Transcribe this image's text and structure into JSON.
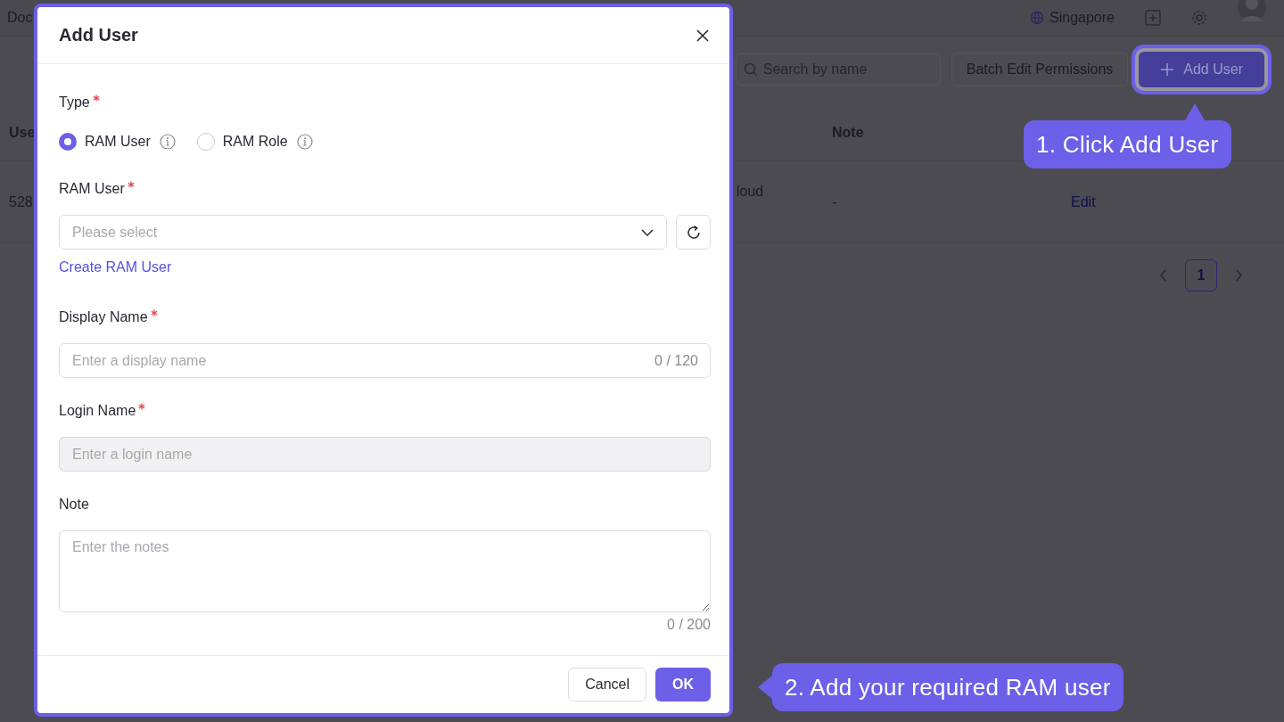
{
  "background_page": {
    "top_bar": {
      "breadcrumb": "Doc",
      "region": "Singapore"
    },
    "toolbar": {
      "search": {
        "placeholder": "Search by name"
      },
      "buttons": [
        {
          "label": "Batch Edit Permissions",
          "kind": "default",
          "highlighted": false
        },
        {
          "label": "Add User",
          "kind": "primary",
          "highlighted": true
        }
      ]
    },
    "table": {
      "columns": [
        "Use",
        "Note"
      ],
      "rows": [
        {
          "column_1": "528",
          "column_2": "loud",
          "note": "-",
          "action": "Edit"
        }
      ]
    },
    "pagination": {
      "pages": [
        {
          "label": "1",
          "selected": true
        }
      ]
    }
  },
  "dialog": {
    "title": "Add User",
    "fields": [
      {
        "kind": "radio",
        "label": "Type",
        "required": true,
        "options": [
          {
            "label": "RAM User",
            "selected": true
          },
          {
            "label": "RAM Role",
            "selected": false
          }
        ]
      },
      {
        "kind": "select",
        "label": "RAM User",
        "required": true,
        "placeholder": "Please select",
        "link": "Create RAM User"
      },
      {
        "kind": "text",
        "label": "Display Name",
        "required": true,
        "placeholder": "Enter a display name",
        "counter": "0 / 120",
        "disabled": false
      },
      {
        "kind": "text",
        "label": "Login Name",
        "required": true,
        "placeholder": "Enter a login name",
        "disabled": true
      },
      {
        "kind": "textarea",
        "label": "Note",
        "required": false,
        "placeholder": "Enter the notes",
        "counter": "0 / 200"
      }
    ],
    "buttons": [
      {
        "label": "Cancel",
        "kind": "default"
      },
      {
        "label": "OK",
        "kind": "primary"
      }
    ]
  },
  "callouts": [
    {
      "text": "1. Click Add User",
      "kind": "up"
    },
    {
      "text": "2. Add your required RAM user",
      "kind": "left"
    }
  ]
}
